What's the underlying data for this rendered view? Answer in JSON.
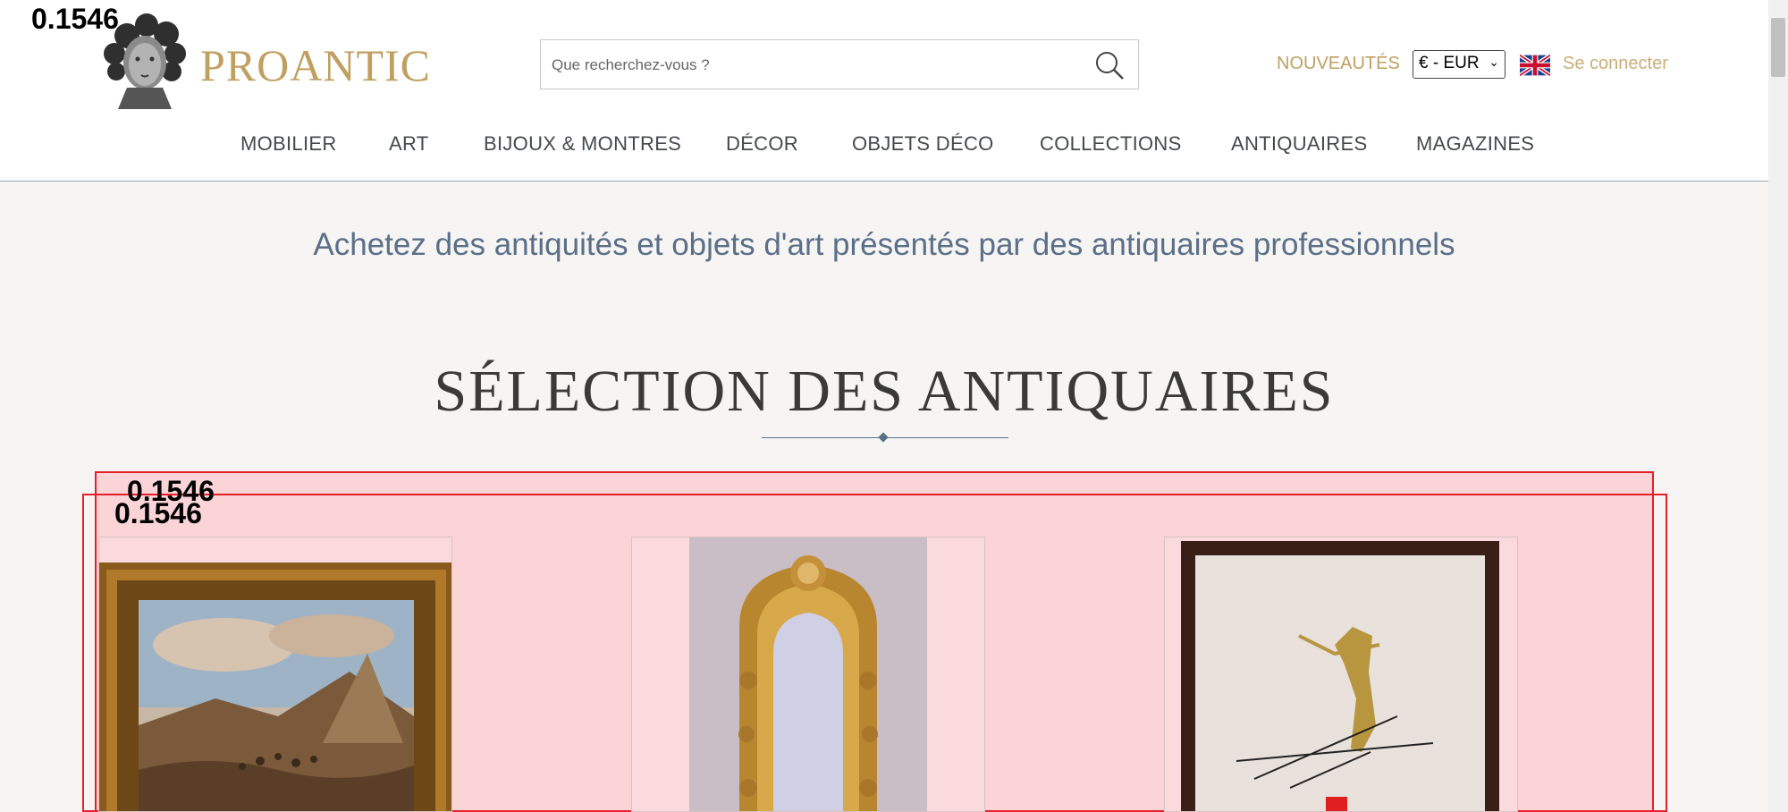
{
  "debug": {
    "score_label": "0.1546"
  },
  "header": {
    "brand": "PROANTIC",
    "search_placeholder": "Que recherchez-vous ?",
    "nouveautes": "NOUVEAUTÉS",
    "currency": "€ - EUR",
    "login": "Se connecter",
    "icons": {
      "search": "search-icon",
      "flag": "uk-flag-icon",
      "logo": "bust-logo-icon"
    }
  },
  "nav": {
    "items": [
      "MOBILIER",
      "ART",
      "BIJOUX & MONTRES",
      "DÉCOR",
      "OBJETS DÉCO",
      "COLLECTIONS",
      "ANTIQUAIRES",
      "MAGAZINES"
    ]
  },
  "tagline": "Achetez des antiquités et objets d'art présentés par des antiquaires professionnels",
  "section": {
    "title": "SÉLECTION DES ANTIQUAIRES"
  },
  "products": [
    {
      "kind": "painting"
    },
    {
      "kind": "mirror"
    },
    {
      "kind": "framed-artwork"
    }
  ],
  "colors": {
    "brand_gold": "#c0a061",
    "nav_text": "#45484d",
    "tagline": "#5b6f88",
    "overlay_red": "#e5202a"
  }
}
